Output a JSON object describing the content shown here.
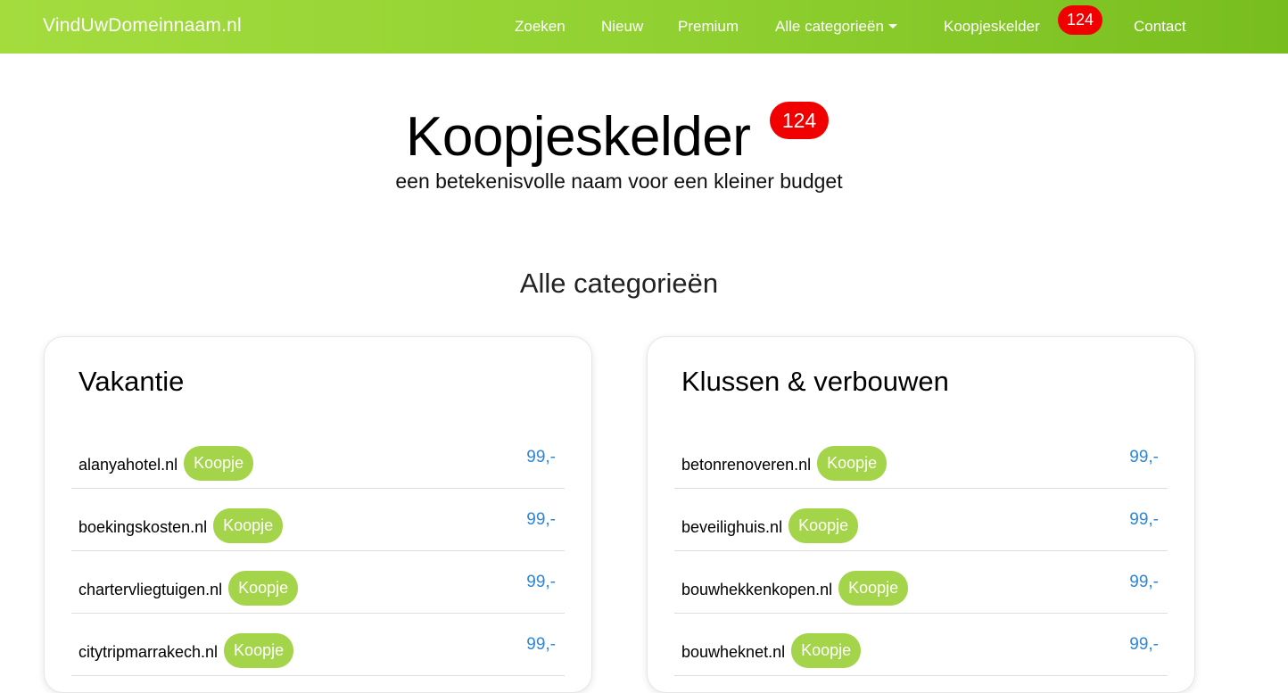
{
  "navbar": {
    "brand": "VindUwDomeinnaam.nl",
    "links": [
      {
        "label": "Zoeken"
      },
      {
        "label": "Nieuw"
      },
      {
        "label": "Premium"
      },
      {
        "label": "Alle categorieën"
      },
      {
        "label": "Koopjeskelder"
      },
      {
        "label": "Contact"
      }
    ],
    "badge": "124"
  },
  "hero": {
    "title": "Koopjeskelder",
    "badge": "124",
    "subtitle": "een betekenisvolle naam voor een kleiner budget"
  },
  "section_title": "Alle categorieën",
  "cards": [
    {
      "title": "Vakantie",
      "rows": [
        {
          "domain": "alanyahotel.nl",
          "tag": "Koopje",
          "price": "99,-"
        },
        {
          "domain": "boekingskosten.nl",
          "tag": "Koopje",
          "price": "99,-"
        },
        {
          "domain": "chartervliegtuigen.nl",
          "tag": "Koopje",
          "price": "99,-"
        },
        {
          "domain": "citytripmarrakech.nl",
          "tag": "Koopje",
          "price": "99,-"
        }
      ]
    },
    {
      "title": "Klussen & verbouwen",
      "rows": [
        {
          "domain": "betonrenoveren.nl",
          "tag": "Koopje",
          "price": "99,-"
        },
        {
          "domain": "beveilighuis.nl",
          "tag": "Koopje",
          "price": "99,-"
        },
        {
          "domain": "bouwhekkenkopen.nl",
          "tag": "Koopje",
          "price": "99,-"
        },
        {
          "domain": "bouwheknet.nl",
          "tag": "Koopje",
          "price": "99,-"
        }
      ]
    }
  ],
  "colors": {
    "nav_green": "#8fd030",
    "badge_red": "#f00000",
    "tag_green": "#a4d44a",
    "price_blue": "#2e86d4"
  }
}
